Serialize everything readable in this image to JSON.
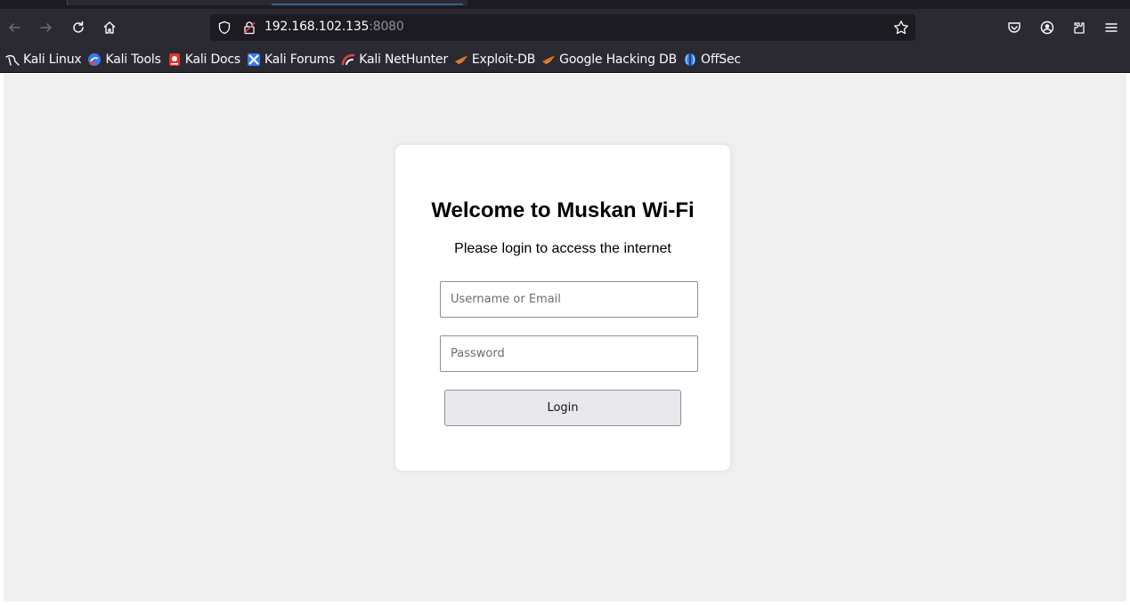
{
  "browser": {
    "url_host": "192.168.102.135",
    "url_port": ":8080",
    "nav": {
      "back_icon": "arrow-left-icon",
      "forward_icon": "arrow-right-icon",
      "reload_icon": "reload-icon",
      "home_icon": "home-icon"
    },
    "toolbar_icons": [
      "pocket-icon",
      "account-icon",
      "extensions-icon",
      "menu-icon"
    ]
  },
  "bookmarks": [
    {
      "label": "Kali Linux",
      "icon": "kali-dragon-icon"
    },
    {
      "label": "Kali Tools",
      "icon": "kali-tools-icon"
    },
    {
      "label": "Kali Docs",
      "icon": "kali-docs-icon"
    },
    {
      "label": "Kali Forums",
      "icon": "kali-forums-icon"
    },
    {
      "label": "Kali NetHunter",
      "icon": "nethunter-icon"
    },
    {
      "label": "Exploit-DB",
      "icon": "exploit-db-icon"
    },
    {
      "label": "Google Hacking DB",
      "icon": "ghdb-icon"
    },
    {
      "label": "OffSec",
      "icon": "offsec-icon"
    }
  ],
  "login": {
    "title": "Welcome to Muskan Wi-Fi",
    "subtitle": "Please login to access the internet",
    "username_placeholder": "Username or Email",
    "password_placeholder": "Password",
    "button_label": "Login"
  },
  "colors": {
    "chrome_bg": "#2b2a33",
    "urlbar_bg": "#1c1b22",
    "page_bg": "#f0f0f0",
    "card_bg": "#ffffff"
  }
}
